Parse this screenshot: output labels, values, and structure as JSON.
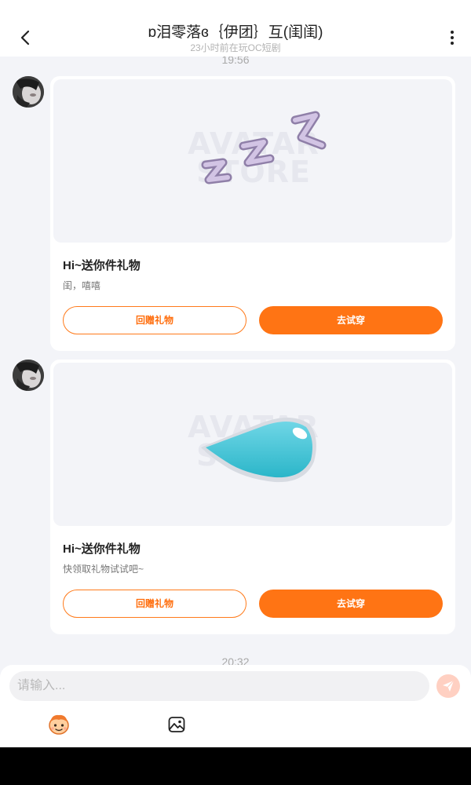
{
  "header": {
    "title": "ɒ泪零落ɞ｛伊团｝互(闺闺)",
    "subtitle": "23小时前在玩OC短剧",
    "back_icon": "chevron-left-icon",
    "more_icon": "more-vertical-icon"
  },
  "timestamps": [
    "19:56",
    "20:32"
  ],
  "messages": [
    {
      "image_icon": "sleeping-zzz-icon",
      "watermark": "AVATAR STORE",
      "title": "Hi~送你件礼物",
      "description": "闺，嘻嘻",
      "return_gift_label": "回赠礼物",
      "try_on_label": "去试穿"
    },
    {
      "image_icon": "water-drop-icon",
      "watermark": "AVATAR STORE",
      "title": "Hi~送你件礼物",
      "description": "快领取礼物试试吧~",
      "return_gift_label": "回赠礼物",
      "try_on_label": "去试穿"
    }
  ],
  "input_bar": {
    "placeholder": "请输入...",
    "send_icon": "paper-plane-icon",
    "tools": [
      "avatar-character-icon",
      "image-icon"
    ]
  },
  "colors": {
    "accent": "#ff7414",
    "background": "#f3f4f8",
    "send_disabled": "#ffd0c2"
  }
}
